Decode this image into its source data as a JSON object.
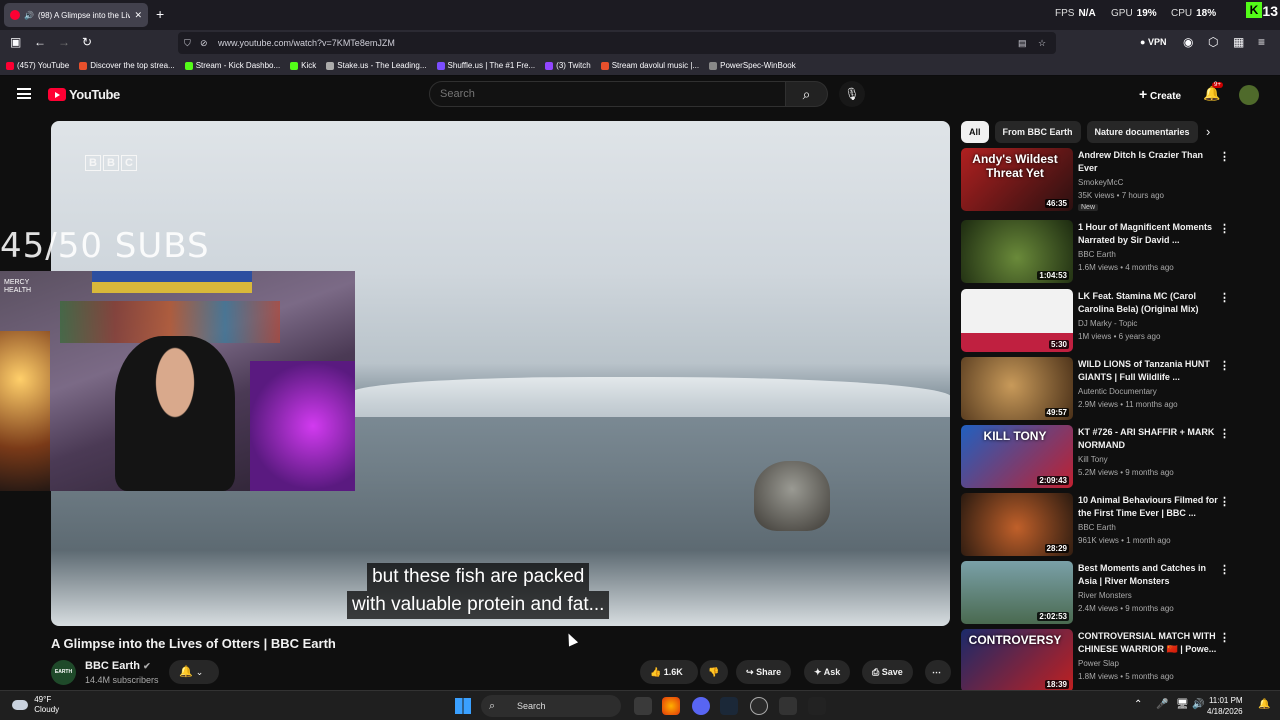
{
  "browser": {
    "tab_title": "(98) A Glimpse into the Liv",
    "url": "www.youtube.com/watch?v=7KMTe8emJZM",
    "vpn_label": "VPN",
    "hud": {
      "fps_label": "FPS",
      "fps_value": "N/A",
      "gpu_label": "GPU",
      "gpu_value": "19%",
      "cpu_label": "CPU",
      "cpu_value": "18%",
      "kick_badge": "K",
      "viewer_count": "13"
    }
  },
  "bookmarks": [
    {
      "label": "(457) YouTube",
      "color": "#ff0033"
    },
    {
      "label": "Discover the top strea...",
      "color": "#e8502c"
    },
    {
      "label": "Stream - Kick Dashbo...",
      "color": "#53fc18"
    },
    {
      "label": "Kick",
      "color": "#53fc18"
    },
    {
      "label": "Stake.us - The Leading...",
      "color": "#aaaaaa"
    },
    {
      "label": "Shuffle.us | The #1 Fre...",
      "color": "#7b4dff"
    },
    {
      "label": "(3) Twitch",
      "color": "#9146ff"
    },
    {
      "label": "Stream davolul music |...",
      "color": "#e8502c"
    },
    {
      "label": "PowerSpec-WinBook",
      "color": "#888888"
    }
  ],
  "youtube": {
    "logo_text": "YouTube",
    "search_placeholder": "Search",
    "create_label": "Create",
    "notif_badge": "9+"
  },
  "video": {
    "watermark": [
      "B",
      "B",
      "C"
    ],
    "caption_line1": "but these fish are packed",
    "caption_line2": "with valuable protein and fat...",
    "title": "A Glimpse into the Lives of Otters | BBC Earth",
    "channel": "BBC Earth",
    "channel_avatar_text": "EARTH",
    "subscribers": "14.4M subscribers",
    "likes": "1.6K",
    "share_label": "Share",
    "ask_label": "Ask",
    "save_label": "Save"
  },
  "overlay": {
    "subs_goal": "45/50 SUBS",
    "webcam_sign": "MERCY\nHEALTH"
  },
  "chips": [
    "All",
    "From BBC Earth",
    "Nature documentaries"
  ],
  "recommendations": [
    {
      "title": "Andrew Ditch Is Crazier Than Ever",
      "channel": "SmokeyMcC",
      "meta": "35K views • 7 hours ago",
      "duration": "46:35",
      "badge": "New",
      "thumb": "linear-gradient(135deg,#b02020,#2a1010)",
      "thumb_text": "Andy's Wildest Threat Yet"
    },
    {
      "title": "1 Hour of Magnificent Moments Narrated by Sir David ...",
      "channel": "BBC Earth",
      "meta": "1.6M views • 4 months ago",
      "duration": "1:04:53",
      "badge": "",
      "thumb": "radial-gradient(circle at 50% 60%,#6a8a3a,#1c2a10)",
      "thumb_text": ""
    },
    {
      "title": "LK Feat. Stamina MC (Carol Carolina Bela) (Original Mix)",
      "channel": "DJ Marky - Topic",
      "meta": "1M views • 6 years ago",
      "duration": "5:30",
      "badge": "",
      "thumb": "linear-gradient(180deg,#f2f2f2 0 70%,#c02040 70%)",
      "thumb_text": ""
    },
    {
      "title": "WILD LIONS of Tanzania HUNT GIANTS | Full Wildlife ...",
      "channel": "Autentic Documentary",
      "meta": "2.9M views • 11 months ago",
      "duration": "49:57",
      "badge": "",
      "thumb": "radial-gradient(circle at 45% 45%,#c89a5a,#4a3018)",
      "thumb_text": ""
    },
    {
      "title": "KT #726 - ARI SHAFFIR + MARK NORMAND",
      "channel": "Kill Tony",
      "meta": "5.2M views • 9 months ago",
      "duration": "2:09:43",
      "badge": "",
      "thumb": "linear-gradient(135deg,#2060c0,#c02030)",
      "thumb_text": "KILL TONY"
    },
    {
      "title": "10 Animal Behaviours Filmed for the First Time Ever | BBC ...",
      "channel": "BBC Earth",
      "meta": "961K views • 1 month ago",
      "duration": "28:29",
      "badge": "",
      "thumb": "radial-gradient(circle at 50% 55%,#c0602a,#2a1a10)",
      "thumb_text": ""
    },
    {
      "title": "Best Moments and Catches in Asia | River Monsters",
      "channel": "River Monsters",
      "meta": "2.4M views • 9 months ago",
      "duration": "2:02:53",
      "badge": "",
      "thumb": "linear-gradient(180deg,#7aa0a8,#4a6a50)",
      "thumb_text": ""
    },
    {
      "title": "CONTROVERSIAL MATCH WITH CHINESE WARRIOR 🇨🇳 | Powe...",
      "channel": "Power Slap",
      "meta": "1.8M views • 5 months ago",
      "duration": "18:39",
      "badge": "",
      "thumb": "linear-gradient(135deg,#1a2a6a,#c02020)",
      "thumb_text": "CONTROVERSY"
    }
  ],
  "taskbar": {
    "temperature": "49°F",
    "condition": "Cloudy",
    "search_label": "Search",
    "time": "11:01 PM",
    "date": "4/18/2026"
  }
}
